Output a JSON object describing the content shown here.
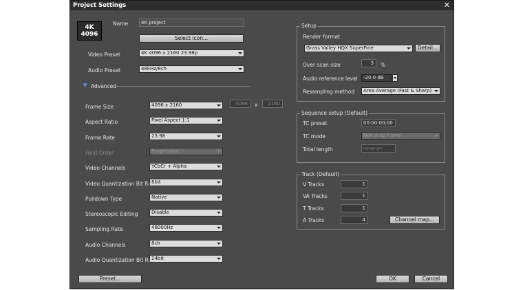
{
  "window": {
    "title": "Project Settings",
    "close_glyph": "✕"
  },
  "logo": {
    "line1": "4K",
    "line2": "4096"
  },
  "left": {
    "name_label": "Name",
    "name_value": "4K project",
    "select_icon": "Select Icon...",
    "video_preset_label": "Video Preset",
    "video_preset": "4K 4096 x 2160 23.98p",
    "audio_preset_label": "Audio Preset",
    "audio_preset": "48kHz/8ch",
    "advanced_label": "Advanced",
    "rows": [
      {
        "label": "Frame Size",
        "value": "4096 x 2160",
        "disabled": false
      },
      {
        "label": "Aspect Ratio",
        "value": "Pixel Aspect 1:1",
        "disabled": false
      },
      {
        "label": "Frame Rate",
        "value": "23.98",
        "disabled": false
      },
      {
        "label": "Field Order",
        "value": "Progressive",
        "disabled": true
      },
      {
        "label": "Video Channels",
        "value": "YCbCr + Alpha",
        "disabled": false
      },
      {
        "label": "Video Quantization Bit Rate",
        "value": "8bit",
        "disabled": false
      },
      {
        "label": "Pulldown Type",
        "value": "Native",
        "disabled": false
      },
      {
        "label": "Stereoscopic Editing",
        "value": "Disable",
        "disabled": false
      },
      {
        "label": "Sampling Rate",
        "value": "48000Hz",
        "disabled": false
      },
      {
        "label": "Audio Channels",
        "value": "8ch",
        "disabled": false
      },
      {
        "label": "Audio Quantization Bit Rate",
        "value": "24bit",
        "disabled": false
      }
    ],
    "frame_w": "4096",
    "frame_x": "x",
    "frame_h": "2160"
  },
  "setup": {
    "title": "Setup",
    "render_format_label": "Render format",
    "render_format": "Grass Valley HQX SuperFine",
    "detail": "Detail...",
    "overscan_label": "Over scan size",
    "overscan": "3",
    "overscan_unit": "%",
    "audio_ref_label": "Audio reference level",
    "audio_ref": "-20.0 dB",
    "resampling_label": "Resampling method",
    "resampling": "Area Average (Fast & Sharp)"
  },
  "sequence": {
    "title": "Sequence setup (Default)",
    "tc_preset_label": "TC preset",
    "tc_preset": "00:00:00;00",
    "tc_mode_label": "TC mode",
    "tc_mode": "Non drop frame",
    "total_length_label": "Total length",
    "total_length": "--:--:--;--"
  },
  "track": {
    "title": "Track (Default)",
    "rows": [
      {
        "label": "V Tracks",
        "value": "1"
      },
      {
        "label": "VA Tracks",
        "value": "1"
      },
      {
        "label": "T Tracks",
        "value": "1"
      },
      {
        "label": "A Tracks",
        "value": "4"
      }
    ],
    "channel_map": "Channel map..."
  },
  "footer": {
    "preset": "Preset...",
    "ok": "OK",
    "cancel": "Cancel"
  }
}
